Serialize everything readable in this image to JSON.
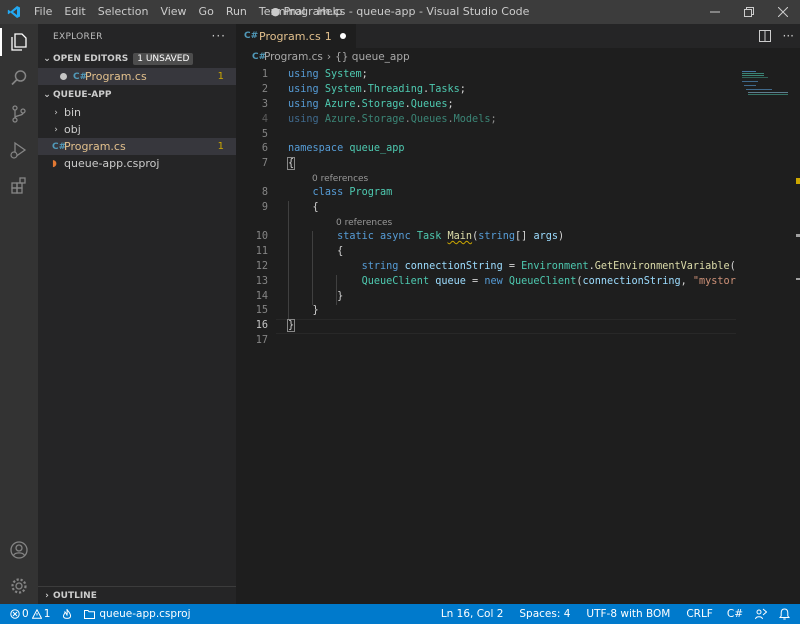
{
  "window": {
    "title": "● Program.cs - queue-app - Visual Studio Code",
    "menu": [
      "File",
      "Edit",
      "Selection",
      "View",
      "Go",
      "Run",
      "Terminal",
      "Help"
    ]
  },
  "activity_bar": {
    "icons": [
      "files-icon",
      "search-icon",
      "source-control-icon",
      "run-debug-icon",
      "extensions-icon"
    ],
    "bottom_icons": [
      "accounts-icon",
      "manage-gear-icon"
    ]
  },
  "sidebar": {
    "title": "EXPLORER",
    "more": "···",
    "open_editors": {
      "label": "OPEN EDITORS",
      "badge": "1 UNSAVED",
      "items": [
        {
          "name": "Program.cs",
          "count": "1"
        }
      ]
    },
    "folder": {
      "label": "QUEUE-APP",
      "items": [
        {
          "name": "bin",
          "type": "folder"
        },
        {
          "name": "obj",
          "type": "folder"
        },
        {
          "name": "Program.cs",
          "type": "cs",
          "count": "1"
        },
        {
          "name": "queue-app.csproj",
          "type": "rss"
        }
      ]
    },
    "outline": "OUTLINE"
  },
  "editor": {
    "tab": {
      "label": "Program.cs",
      "problems": "1"
    },
    "breadcrumb": {
      "file": "Program.cs",
      "symbol": "{} queue_app"
    },
    "code_lens": "0 references",
    "current_line": 16,
    "line_numbers": [
      "1",
      "2",
      "3",
      "4",
      "5",
      "6",
      "7",
      "8",
      "9",
      "10",
      "11",
      "12",
      "13",
      "14",
      "15",
      "16",
      "17"
    ]
  },
  "statusbar": {
    "errors": "0",
    "warnings": "1",
    "project": "queue-app.csproj",
    "position": "Ln 16, Col 2",
    "spaces": "Spaces: 4",
    "encoding": "UTF-8 with BOM",
    "eol": "CRLF",
    "language": "C#"
  },
  "colors": {
    "accent": "#007acc",
    "keyword": "#569cd6",
    "type": "#4ec9b0",
    "function": "#dcdcaa",
    "string": "#ce9178",
    "variable": "#9cdcfe",
    "modified": "#e2c08d"
  }
}
